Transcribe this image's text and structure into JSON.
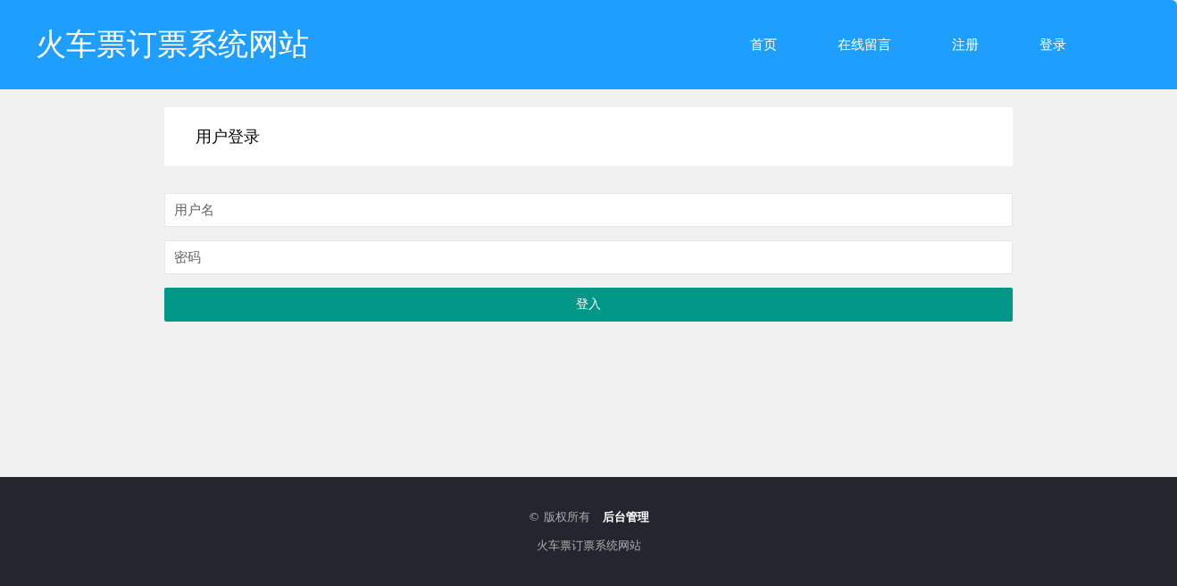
{
  "header": {
    "title": "火车票订票系统网站",
    "nav": [
      {
        "label": "首页"
      },
      {
        "label": "在线留言"
      },
      {
        "label": "注册"
      },
      {
        "label": "登录"
      }
    ]
  },
  "login": {
    "title": "用户登录",
    "fields": [
      {
        "placeholder": "用户名"
      },
      {
        "placeholder": "密码"
      }
    ],
    "submit": "登入"
  },
  "footer": {
    "copyright": "© 版权所有",
    "admin_link": "后台管理",
    "site_name": "火车票订票系统网站"
  }
}
